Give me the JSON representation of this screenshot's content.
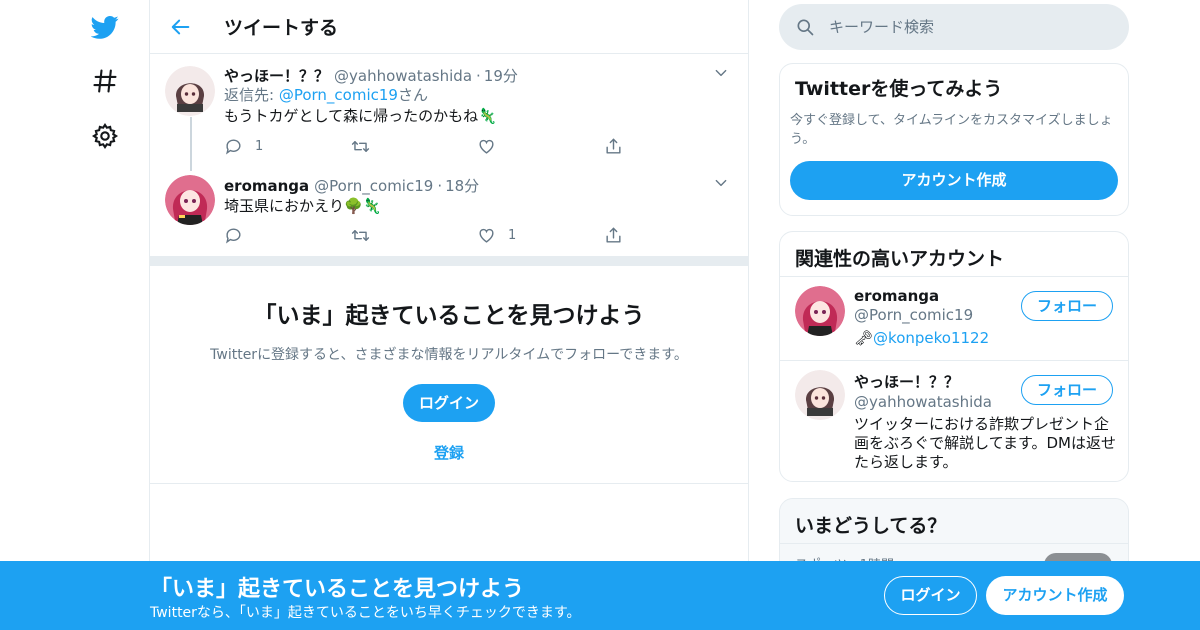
{
  "nav": {
    "icons": [
      "twitter-logo-icon",
      "hashtag-icon",
      "gear-icon"
    ]
  },
  "header": {
    "title": "ツイートする"
  },
  "tweets": [
    {
      "name": "やっほー！？？",
      "handle": "@yahhowatashida",
      "time": "19分",
      "reply_prefix": "返信先: ",
      "reply_to": "@Porn_comic19",
      "reply_suffix": "さん",
      "text": "もうトカゲとして森に帰ったのかもね🦎",
      "reply_count": "1",
      "retweet_count": "",
      "like_count": "",
      "avatar_color": "#f3eaea"
    },
    {
      "name": "eromanga",
      "handle": "@Porn_comic19",
      "time": "18分",
      "text": "埼玉県におかえり🌳🦎",
      "reply_count": "",
      "retweet_count": "",
      "like_count": "1",
      "avatar_color": "#d4456d"
    }
  ],
  "cta": {
    "title": "「いま」起きていることを見つけよう",
    "subtitle": "Twitterに登録すると、さまざまな情報をリアルタイムでフォローできます。",
    "login": "ログイン",
    "signup": "登録"
  },
  "search": {
    "placeholder": "キーワード検索"
  },
  "try_card": {
    "title": "Twitterを使ってみよう",
    "description": "今すぐ登録して、タイムラインをカスタマイズしましょう。",
    "button": "アカウント作成"
  },
  "related": {
    "title": "関連性の高いアカウント",
    "accounts": [
      {
        "name": "eromanga",
        "handle": "@Porn_comic19",
        "bio_prefix": "🗝",
        "bio_mention": "@konpeko1122",
        "bio": "",
        "follow": "フォロー"
      },
      {
        "name": "やっほー！？？",
        "handle": "@yahhowatashida",
        "bio_prefix": "",
        "bio_mention": "",
        "bio": "ツイッターにおける詐欺プレゼント企画をぶろぐで解説してます。DMは返せたら返します。",
        "follow": "フォロー"
      }
    ]
  },
  "trends": {
    "title": "いまどうしてる？",
    "meta": "スポーツ・1時間"
  },
  "banner": {
    "title": "「いま」起きていることを見つけよう",
    "subtitle": "Twitterなら、「いま」起きていることをいち早くチェックできます。",
    "login": "ログイン",
    "signup": "アカウント作成"
  },
  "colors": {
    "accent": "#1da1f2",
    "border": "#e6ecf0",
    "muted": "#657786"
  }
}
